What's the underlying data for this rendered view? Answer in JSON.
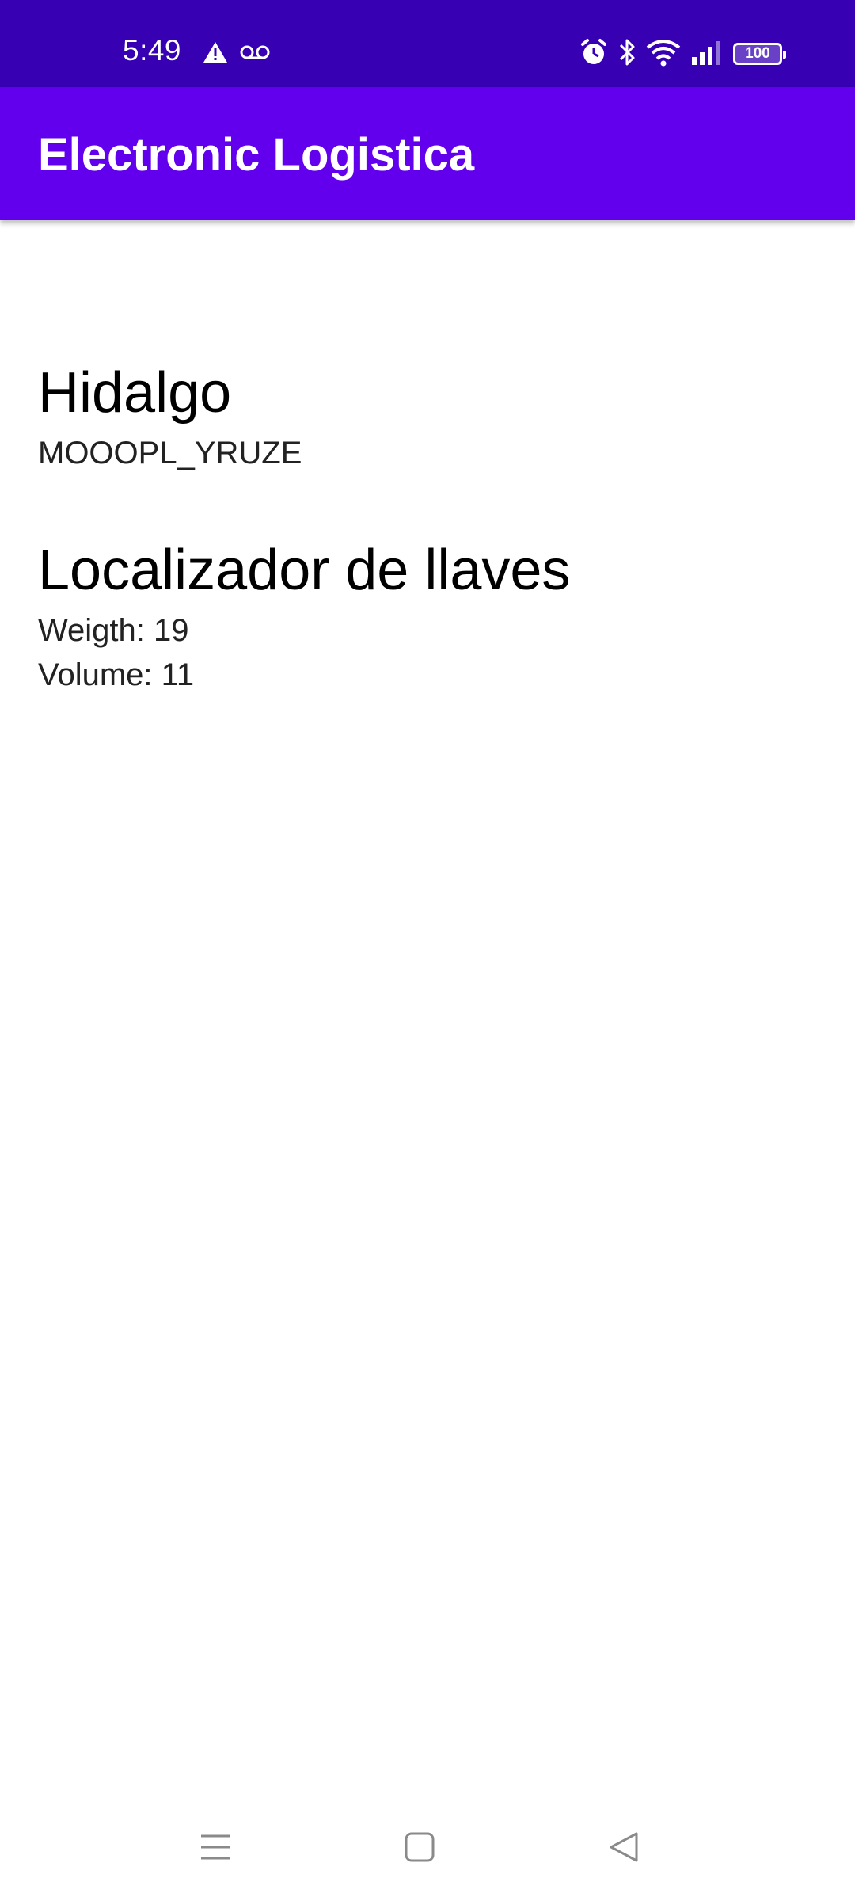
{
  "status_bar": {
    "time": "5:49",
    "icons": [
      "warning-icon",
      "voicemail-icon",
      "alarm-icon",
      "bluetooth-icon",
      "wifi-icon",
      "signal-icon",
      "battery-icon"
    ],
    "battery_level": "100"
  },
  "app_bar": {
    "title": "Electronic Logistica"
  },
  "main": {
    "location": {
      "name": "Hidalgo",
      "code": "MOOOPL_YRUZE"
    },
    "product": {
      "name": "Localizador de llaves",
      "weight": "Weigth: 19",
      "volume": "Volume: 11"
    }
  },
  "nav_bar": {
    "buttons": [
      "menu-icon",
      "home-icon",
      "back-icon"
    ]
  },
  "colors": {
    "status_bar": "#3700b3",
    "app_bar": "#6200ee",
    "background": "#ffffff"
  }
}
